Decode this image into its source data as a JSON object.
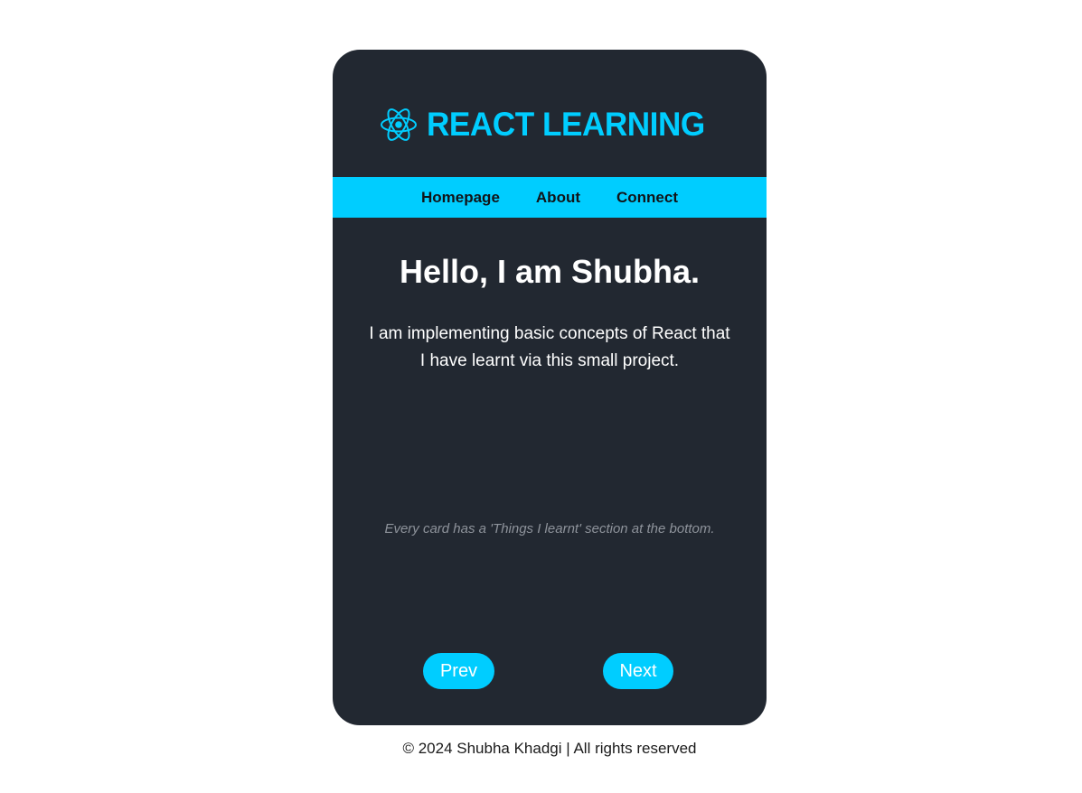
{
  "brand": {
    "title": "REACT LEARNING",
    "icon": "react-atom-icon",
    "accent_color": "#00cdff"
  },
  "nav": {
    "items": [
      {
        "label": "Homepage"
      },
      {
        "label": "About"
      },
      {
        "label": "Connect"
      }
    ]
  },
  "content": {
    "heading": "Hello, I am Shubha.",
    "intro": "I am implementing basic concepts of React that I have learnt via this small project.",
    "note": "Every card has a 'Things I learnt' section at the bottom."
  },
  "pagination": {
    "prev_label": "Prev",
    "next_label": "Next"
  },
  "footer": {
    "text": "© 2024 Shubha Khadgi | All rights reserved"
  },
  "colors": {
    "card_background": "#222831",
    "page_background": "#ffffff",
    "accent": "#00cdff"
  }
}
